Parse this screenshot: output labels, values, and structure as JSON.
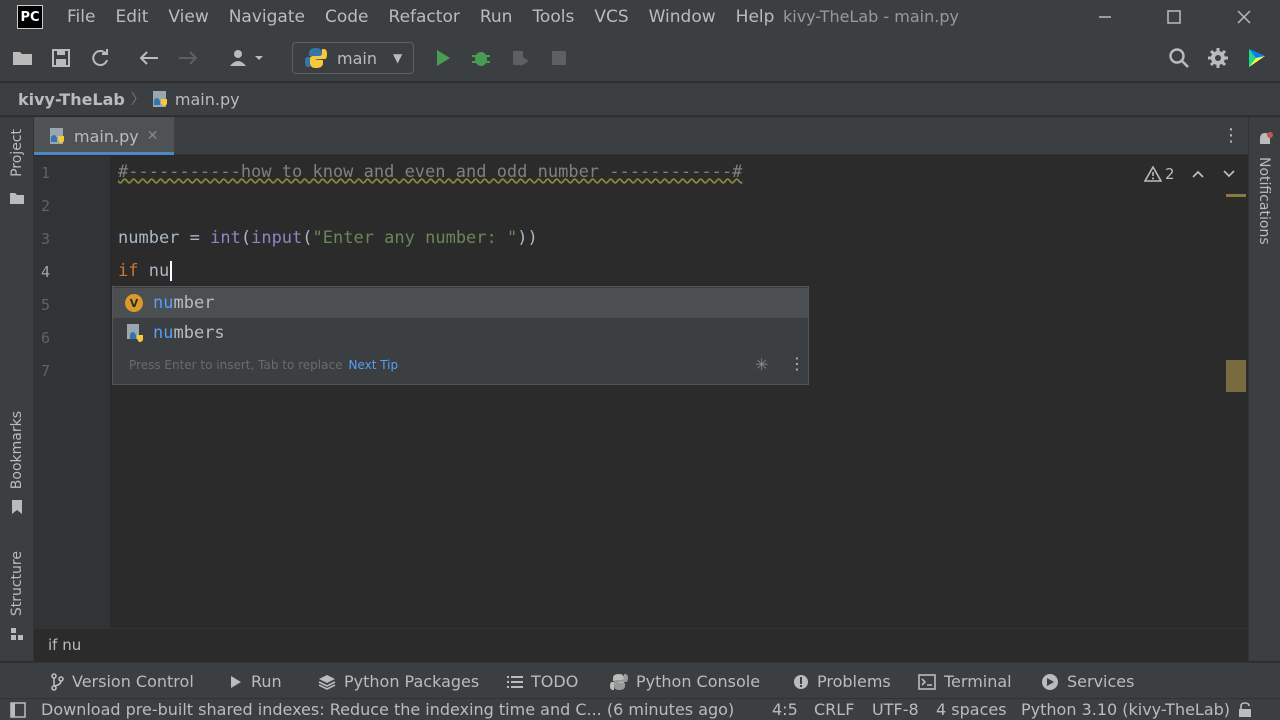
{
  "app": {
    "logo_text": "PC",
    "window_title": "kivy-TheLab - main.py"
  },
  "menu": [
    "File",
    "Edit",
    "View",
    "Navigate",
    "Code",
    "Refactor",
    "Run",
    "Tools",
    "VCS",
    "Window",
    "Help"
  ],
  "toolbar": {
    "run_config": "main"
  },
  "breadcrumb": {
    "project": "kivy-TheLab",
    "file": "main.py"
  },
  "side_tools": {
    "project": "Project",
    "bookmarks": "Bookmarks",
    "structure": "Structure",
    "notifications": "Notifications"
  },
  "tab": {
    "label": "main.py",
    "close": "✕"
  },
  "editor": {
    "line_numbers": [
      "1",
      "2",
      "3",
      "4",
      "5",
      "6",
      "7"
    ],
    "line1": "#-----------how to know and even and odd number ------------#",
    "line3_a": "number = ",
    "line3_int": "int",
    "line3_paren": "(",
    "line3_input": "input",
    "line3_paren2": "(",
    "line3_str": "\"Enter any number: \"",
    "line3_end": "))",
    "line4_kw": "if",
    "line4_rest": " nu",
    "inspection_count": "2"
  },
  "completion": {
    "items": [
      {
        "match": "nu",
        "rest": "mber",
        "icon": "variable-icon"
      },
      {
        "match": "nu",
        "rest": "mbers",
        "icon": "python-module-icon"
      }
    ],
    "footer": "Press Enter to insert, Tab to replace",
    "next_tip": "Next Tip"
  },
  "context": "if nu",
  "tool_windows": {
    "version_control": "Version Control",
    "run": "Run",
    "python_packages": "Python Packages",
    "todo": "TODO",
    "python_console": "Python Console",
    "problems": "Problems",
    "terminal": "Terminal",
    "services": "Services"
  },
  "status": {
    "message": "Download pre-built shared indexes: Reduce the indexing time and C... (6 minutes ago)",
    "position": "4:5",
    "line_sep": "CRLF",
    "encoding": "UTF-8",
    "indent": "4 spaces",
    "interpreter": "Python 3.10 (kivy-TheLab)"
  },
  "colors": {
    "accent": "#4a88c7",
    "run_green": "#499c54",
    "comment": "#808080",
    "keyword": "#cc7832",
    "string": "#6a8759",
    "match": "#589df6"
  }
}
